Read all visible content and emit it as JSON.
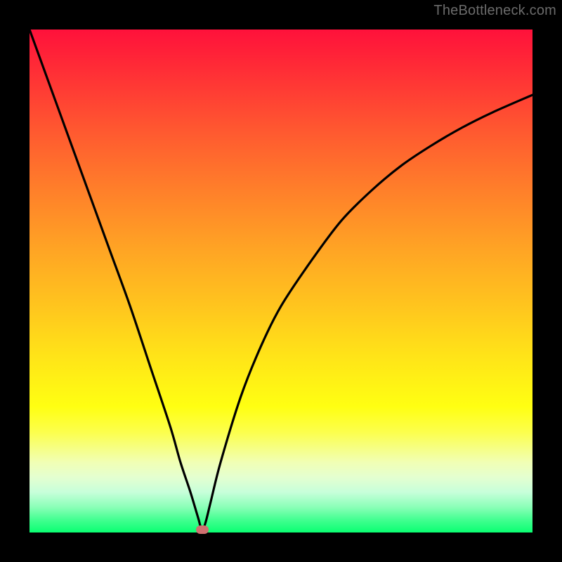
{
  "watermark": "TheBottleneck.com",
  "colors": {
    "frame": "#000000",
    "curve": "#000000",
    "marker": "#cf7070"
  },
  "chart_data": {
    "type": "line",
    "title": "",
    "xlabel": "",
    "ylabel": "",
    "xlim": [
      0,
      100
    ],
    "ylim": [
      0,
      100
    ],
    "x": [
      0,
      4,
      8,
      12,
      16,
      20,
      24,
      28,
      30,
      32,
      33.5,
      34.3,
      35,
      36,
      38,
      42,
      46,
      50,
      56,
      62,
      68,
      74,
      80,
      86,
      92,
      100
    ],
    "values": [
      100,
      89,
      78,
      67,
      56,
      45,
      33,
      21,
      14,
      8,
      3,
      0.5,
      2,
      6,
      14,
      27,
      37,
      45,
      54,
      62,
      68,
      73,
      77,
      80.5,
      83.5,
      87
    ],
    "marker": {
      "x": 34.3,
      "y": 0.5
    },
    "grid": false,
    "legend": false
  }
}
